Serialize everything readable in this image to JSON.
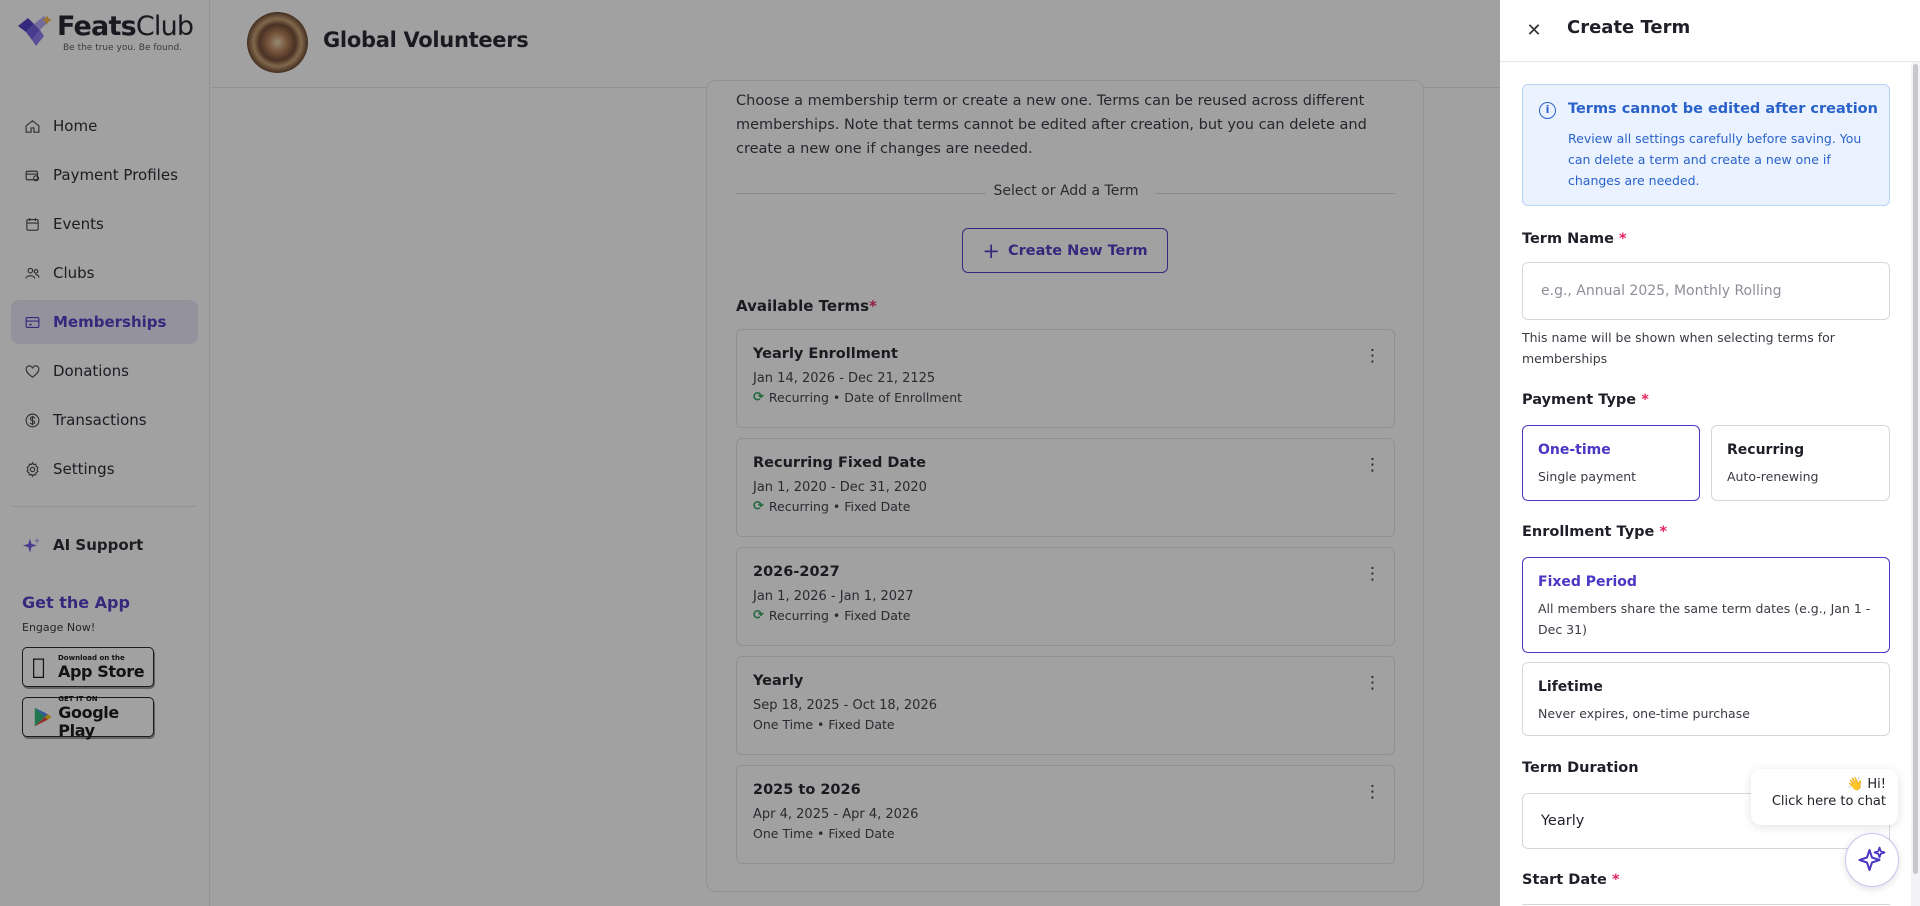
{
  "brand": {
    "name_bold": "Feats",
    "name_light": "Club",
    "tagline": "Be the true you. Be found.",
    "accent": "#4a37c4"
  },
  "sidebar": {
    "items": [
      {
        "label": "Home",
        "icon": "home-icon"
      },
      {
        "label": "Payment Profiles",
        "icon": "payment-profiles-icon"
      },
      {
        "label": "Events",
        "icon": "calendar-icon"
      },
      {
        "label": "Clubs",
        "icon": "users-icon"
      },
      {
        "label": "Memberships",
        "icon": "card-icon",
        "active": true
      },
      {
        "label": "Donations",
        "icon": "heart-icon"
      },
      {
        "label": "Transactions",
        "icon": "dollar-icon"
      },
      {
        "label": "Settings",
        "icon": "gear-icon"
      }
    ],
    "ai_support": "AI Support",
    "get_app": "Get the App",
    "engage": "Engage Now!",
    "app_store": {
      "small": "Download on the",
      "big": "App Store"
    },
    "google_play": {
      "small": "GET IT ON",
      "big": "Google Play"
    }
  },
  "header": {
    "org_name": "Global Volunteers"
  },
  "main": {
    "intro": "Choose a membership term or create a new one. Terms can be reused across different memberships. Note that terms cannot be edited after creation, but you can delete and create a new one if changes are needed.",
    "separator_label": "Select or Add a Term",
    "create_button": "Create New Term",
    "available_terms_label": "Available Terms",
    "terms": [
      {
        "title": "Yearly Enrollment",
        "dates": "Jan 14, 2026 - Dec 21, 2125",
        "meta": "Recurring • Date of Enrollment",
        "recurring": true
      },
      {
        "title": "Recurring Fixed Date",
        "dates": "Jan 1, 2020 - Dec 31, 2020",
        "meta": "Recurring • Fixed Date",
        "recurring": true
      },
      {
        "title": "2026-2027",
        "dates": "Jan 1, 2026 - Jan 1, 2027",
        "meta": "Recurring • Fixed Date",
        "recurring": true
      },
      {
        "title": "Yearly",
        "dates": "Sep 18, 2025 - Oct 18, 2026",
        "meta": "One Time • Fixed Date",
        "recurring": false
      },
      {
        "title": "2025 to 2026",
        "dates": "Apr 4, 2025 - Apr 4, 2026",
        "meta": "One Time • Fixed Date",
        "recurring": false
      }
    ]
  },
  "drawer": {
    "title": "Create Term",
    "info_title": "Terms cannot be edited after creation",
    "info_body": "Review all settings carefully before saving. You can delete a term and create a new one if changes are needed.",
    "term_name_label": "Term Name",
    "term_name_placeholder": "e.g., Annual 2025, Monthly Rolling",
    "term_name_helper": "This name will be shown when selecting terms for memberships",
    "payment_type_label": "Payment Type",
    "payment_types": [
      {
        "title": "One-time",
        "sub": "Single payment",
        "selected": true
      },
      {
        "title": "Recurring",
        "sub": "Auto-renewing",
        "selected": false
      }
    ],
    "enrollment_type_label": "Enrollment Type",
    "enrollment_types": [
      {
        "title": "Fixed Period",
        "sub": "All members share the same term dates (e.g., Jan 1 - Dec 31)",
        "selected": true
      },
      {
        "title": "Lifetime",
        "sub": "Never expires, one-time purchase",
        "selected": false
      }
    ],
    "term_duration_label": "Term Duration",
    "term_duration_value": "Yearly",
    "start_date_label": "Start Date"
  },
  "chat": {
    "hi": "👋 Hi!",
    "sub": "Click here to chat"
  }
}
